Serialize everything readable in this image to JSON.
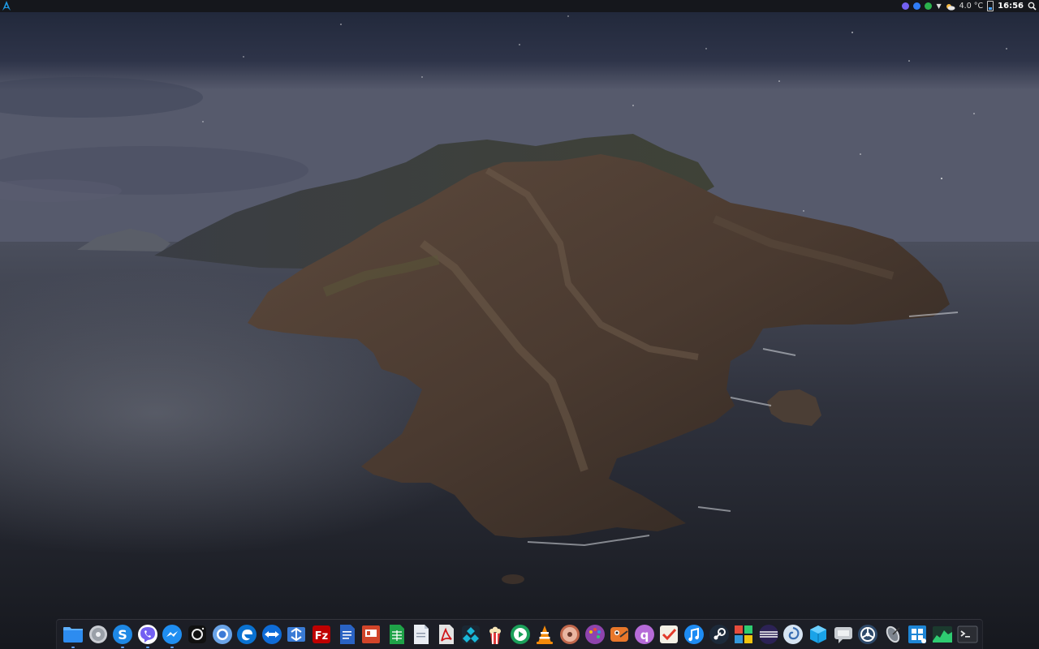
{
  "top_panel": {
    "launcher_icon": "arch-logo-icon",
    "tray": [
      {
        "name": "viber-tray-icon",
        "color": "#7360f2"
      },
      {
        "name": "messenger-tray-icon",
        "color": "#2f7cf6"
      },
      {
        "name": "update-check-icon",
        "color": "#2bb24c"
      }
    ],
    "weather": {
      "icon": "cloud-sun-icon",
      "temperature": "4.0 °C"
    },
    "battery_icon": "battery-icon",
    "clock": "16:56",
    "search_icon": "search-icon"
  },
  "dock": {
    "items": [
      {
        "name": "files",
        "icon": "folder-icon"
      },
      {
        "name": "disks",
        "icon": "disk-icon"
      },
      {
        "name": "skype",
        "icon": "skype-icon"
      },
      {
        "name": "viber",
        "icon": "viber-icon"
      },
      {
        "name": "messenger",
        "icon": "messenger-icon"
      },
      {
        "name": "camera",
        "icon": "camera-icon"
      },
      {
        "name": "chromium",
        "icon": "chromium-icon"
      },
      {
        "name": "edge",
        "icon": "edge-icon"
      },
      {
        "name": "teamviewer",
        "icon": "teamviewer-icon"
      },
      {
        "name": "network-transfer",
        "icon": "network-arrows-icon"
      },
      {
        "name": "filezilla",
        "icon": "filezilla-icon"
      },
      {
        "name": "writer",
        "icon": "document-blue-icon"
      },
      {
        "name": "presentation",
        "icon": "presentation-icon"
      },
      {
        "name": "spreadsheet",
        "icon": "spreadsheet-icon"
      },
      {
        "name": "text-document",
        "icon": "document-white-icon"
      },
      {
        "name": "pdf-reader",
        "icon": "pdf-icon"
      },
      {
        "name": "kodi",
        "icon": "kodi-icon"
      },
      {
        "name": "popcorn-time",
        "icon": "popcorn-icon"
      },
      {
        "name": "media-player",
        "icon": "play-circle-icon"
      },
      {
        "name": "vlc",
        "icon": "vlc-cone-icon"
      },
      {
        "name": "disc-burner",
        "icon": "disc-icon"
      },
      {
        "name": "color-picker",
        "icon": "palette-icon"
      },
      {
        "name": "gimp",
        "icon": "gimp-icon"
      },
      {
        "name": "qbittorrent",
        "icon": "qbittorrent-icon"
      },
      {
        "name": "task-manager",
        "icon": "checklist-icon"
      },
      {
        "name": "music",
        "icon": "music-note-icon"
      },
      {
        "name": "steam",
        "icon": "steam-icon"
      },
      {
        "name": "software-center",
        "icon": "colored-tiles-icon"
      },
      {
        "name": "eclipse",
        "icon": "eclipse-icon"
      },
      {
        "name": "cloud-sync",
        "icon": "swirl-icon"
      },
      {
        "name": "virtualbox",
        "icon": "cube-icon"
      },
      {
        "name": "chat",
        "icon": "speech-bubble-icon"
      },
      {
        "name": "settings-wheel",
        "icon": "wheel-icon"
      },
      {
        "name": "satellite",
        "icon": "satellite-dish-icon"
      },
      {
        "name": "windows-vm",
        "icon": "windows-icon"
      },
      {
        "name": "system-monitor",
        "icon": "graph-area-icon"
      },
      {
        "name": "terminal",
        "icon": "terminal-icon"
      }
    ],
    "running": [
      "files",
      "skype",
      "viber",
      "messenger"
    ]
  }
}
